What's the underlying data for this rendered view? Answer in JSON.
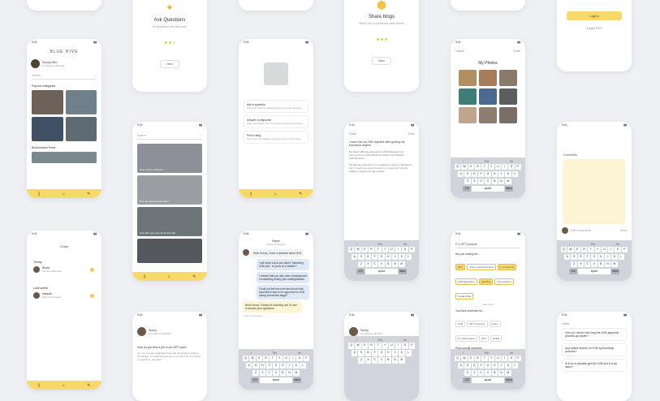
{
  "status": {
    "time": "9:41"
  },
  "onboarding": {
    "ask": {
      "title": "Ask Questions",
      "subtitle": "All questions are welcome!",
      "next": "Next"
    },
    "share": {
      "title": "Share blogs",
      "subtitle": "Share your experiences with others!",
      "next": "Next"
    },
    "login": {
      "button": "Log in",
      "forgot": "Forgot PIN?"
    }
  },
  "home": {
    "brand": "BLUE HIVE",
    "user_name": "Sunny Kim",
    "user_sub": "1st Masters (BUNNI)",
    "search_placeholder": "Search",
    "popular": "Popular categories",
    "bookmarked": "Bookmarked Posts"
  },
  "feed": {
    "search_placeholder": "Search",
    "captions": [
      "How I got an H1B job...",
      "How do I get sponsorship?",
      "How did I get experience through...",
      ""
    ]
  },
  "howto": {
    "items": [
      {
        "title": "Ask a question",
        "desc": "Ask your H1B job related questions to get answers"
      },
      {
        "title": "Answer a response",
        "desc": "Help your fellow users by answering their questions"
      },
      {
        "title": "Find a blog",
        "desc": "Grow your knowledge of various topics with others"
      }
    ]
  },
  "compose": {
    "header_left": "Chats",
    "header_right": "Post",
    "body": "I have had my H1B rejected after getting my bachelors degree.",
    "body2": "My initial H1B was approved in 2015 May and I got approved from 2015-2018 and 2018 under Masters CAP.Students.",
    "body3": "My attorney said that I'm not eligible to apply in \"Bachelors cap\" I need to go out of country for 1 year and I can be eligible to apply new cap petition."
  },
  "photos": {
    "header": "Chats",
    "title": "My Photos",
    "left": "Cancel"
  },
  "comments": {
    "label": "Comments",
    "placeholder": "Add a comment...",
    "send": "Send"
  },
  "chats": {
    "title": "Chats",
    "today": "Today",
    "last_week": "Last week",
    "people": [
      {
        "name": "Bryan",
        "sub": "Mentor at Bumble"
      },
      {
        "name": "Hannah",
        "sub": "Mentor at Fintech"
      }
    ]
  },
  "chat": {
    "name": "Bryan",
    "sub": "Mentor at Fintech",
    "messages": [
      "Hello Sunny, I have a question about H1B",
      "I will reach out to you about \"Marketing H1B jobs\". Is yours on a Master?",
      "I noticed that you also have a background in marketing during your undergraduate.",
      "Could you tell me more about how that experience was to be approved for H1B during a business stage?",
      "Hello Sunny. Thanks for reaching out! I'd love to answer your questions."
    ],
    "placeholder": "Write a message..."
  },
  "keyboard": {
    "sugg": [
      "I",
      "The",
      "I'm"
    ],
    "rows": [
      [
        "Q",
        "W",
        "E",
        "R",
        "T",
        "Y",
        "U",
        "I",
        "O",
        "P"
      ],
      [
        "A",
        "S",
        "D",
        "F",
        "G",
        "H",
        "J",
        "K",
        "L"
      ],
      [
        "Z",
        "X",
        "C",
        "V",
        "B",
        "N",
        "M"
      ]
    ],
    "space": "space",
    "ret": "return",
    "num": "123"
  },
  "filters": {
    "query": "F-1 OPT process",
    "looking_for": "Are you looking for...",
    "chips": [
      "OPT",
      "Green card application",
      "F-1 students",
      "H1B application",
      "deadline",
      "immunization",
      "residentship"
    ],
    "see_more": "See more",
    "searched": "You have searched for...",
    "tags": [
      "H1B",
      "OPT extension",
      "lottery",
      "F-1 2019 status",
      "OPT",
      "STEM"
    ],
    "popular": "Post popular searches",
    "see_more2": "See more"
  },
  "profile": {
    "name": "Sunny",
    "sub": "1st Masters (BUNNI)",
    "post": "How do you find a job on an OPT visa?",
    "body": "Hi, I am a newly graduated international student studying UX Design. I'm searching for job on my OPT but I'm having a tough time. Any tips?"
  },
  "answer": {
    "name": "Sunny",
    "sub": "1st Masters (BUNNI)"
  },
  "faq": {
    "header": "Chats",
    "items": [
      {
        "q": "How do I know how long the H1B approval process go faster?"
      },
      {
        "q": "Any failure stories on H1B sponsorship process?"
      },
      {
        "q": "Is it ok to actually get the H1B and it is an issue?"
      }
    ]
  }
}
